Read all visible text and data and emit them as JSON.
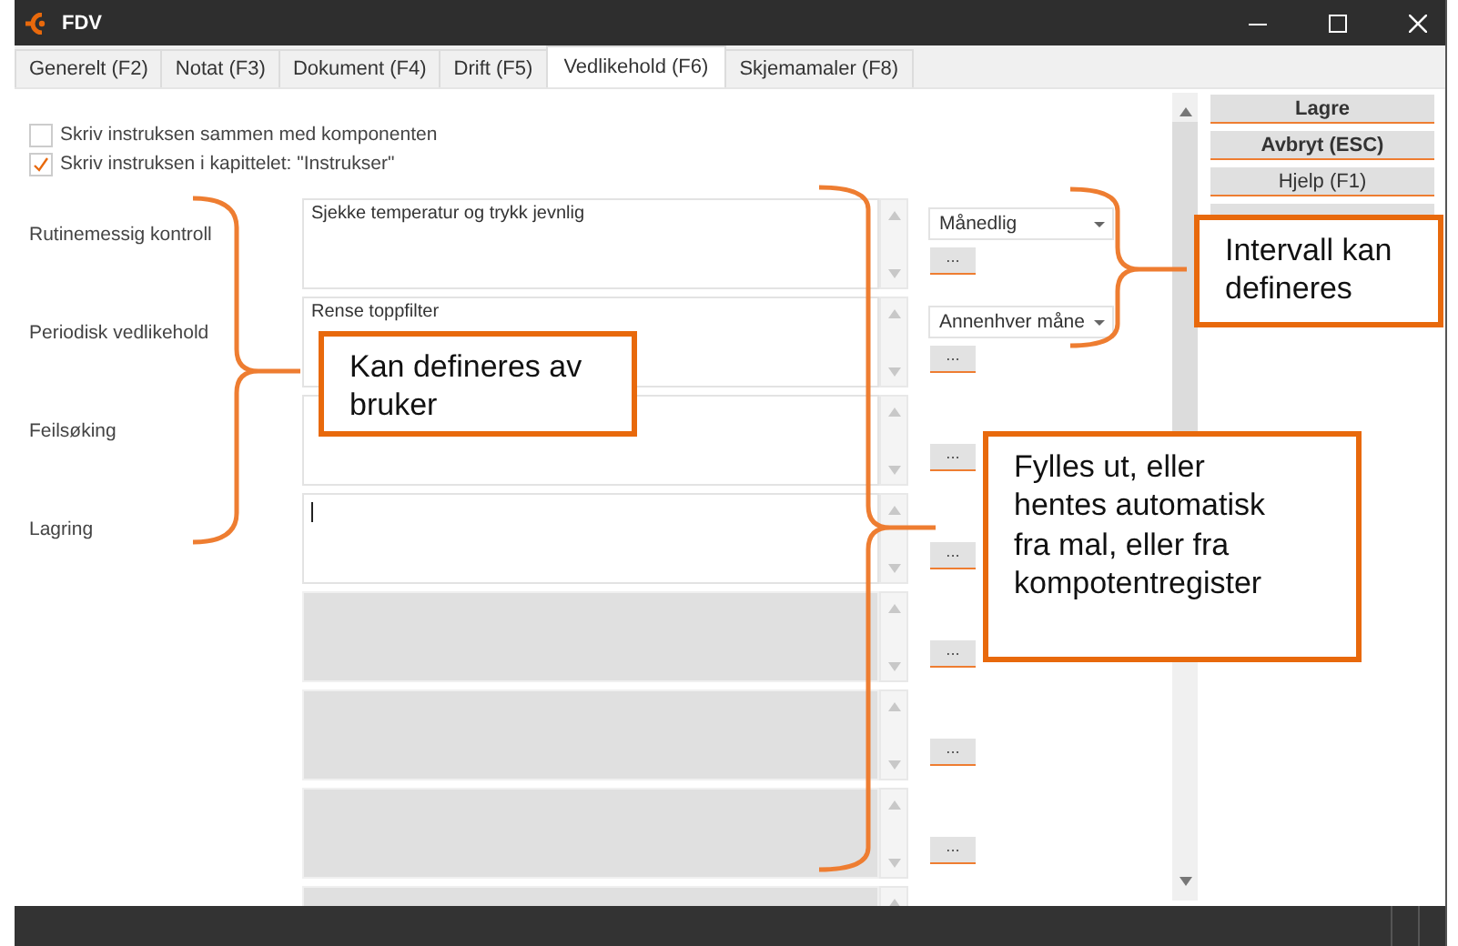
{
  "window": {
    "title": "FDV"
  },
  "tabs": [
    {
      "label": "Generelt (F2)",
      "selected": false
    },
    {
      "label": "Notat (F3)",
      "selected": false
    },
    {
      "label": "Dokument (F4)",
      "selected": false
    },
    {
      "label": "Drift (F5)",
      "selected": false
    },
    {
      "label": "Vedlikehold (F6)",
      "selected": true
    },
    {
      "label": "Skjemamaler (F8)",
      "selected": false
    }
  ],
  "options": [
    {
      "label": "Skriv instruksen sammen med komponenten",
      "checked": false
    },
    {
      "label": "Skriv instruksen i kapittelet: \"Instrukser\"",
      "checked": true
    }
  ],
  "rows": [
    {
      "label": "Rutinemessig kontroll",
      "text": "Sjekke temperatur og trykk jevnlig",
      "interval": "Månedlig",
      "button": "...",
      "disabled": false,
      "focused": false
    },
    {
      "label": "Periodisk vedlikehold",
      "text": "Rense toppfilter",
      "interval": "Annenhver måne",
      "button": "...",
      "disabled": false,
      "focused": false
    },
    {
      "label": "Feilsøking",
      "button": "...",
      "disabled": false,
      "focused": false
    },
    {
      "label": "Lagring",
      "button": "...",
      "disabled": false,
      "focused": true
    },
    {
      "button": "...",
      "disabled": true,
      "focused": false
    },
    {
      "button": "...",
      "disabled": true,
      "focused": false
    },
    {
      "button": "...",
      "disabled": true,
      "focused": false
    },
    {
      "disabled": true,
      "focused": false
    }
  ],
  "actions": [
    {
      "label": "Lagre",
      "bold": true
    },
    {
      "label": "Avbryt (ESC)",
      "bold": true
    },
    {
      "label": "Hjelp (F1)",
      "bold": false
    }
  ],
  "annotations": [
    {
      "text": "Kan defineres av bruker"
    },
    {
      "text": "Intervall kan defineres"
    },
    {
      "text": "Fylles ut, eller hentes automatisk fra mal, eller fra kompotentregister"
    }
  ]
}
